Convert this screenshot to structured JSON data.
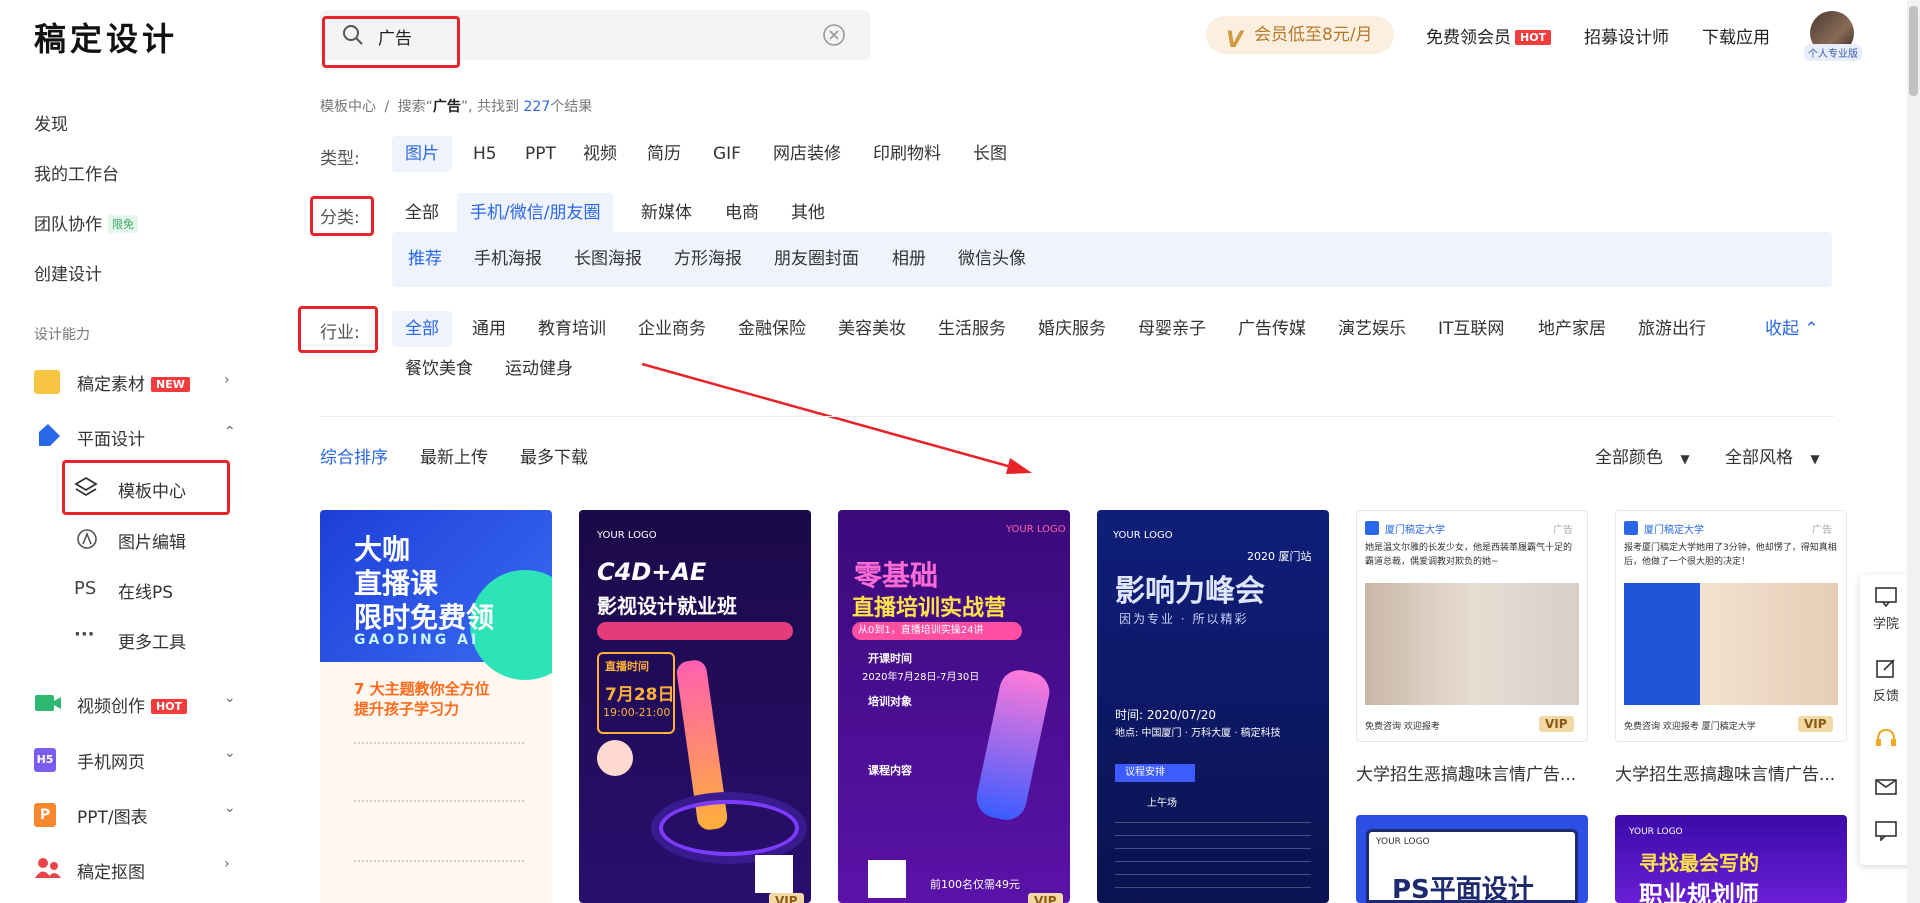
{
  "header": {
    "logo": "稿定设计",
    "search_value": "广告",
    "vip_label": "会员低至8元/月",
    "free_vip": "免费领会员",
    "hot": "HOT",
    "recruit": "招募设计师",
    "download": "下载应用",
    "avatar_badge": "个人专业版"
  },
  "sidebar": {
    "discover": "发现",
    "workbench": "我的工作台",
    "team": "团队协作",
    "team_tag": "限免",
    "create": "创建设计",
    "section": "设计能力",
    "materials": "稿定素材",
    "materials_tag": "NEW",
    "graphic": "平面设计",
    "template_center": "模板中心",
    "image_edit": "图片编辑",
    "online_ps": "在线PS",
    "ps_icon": "PS",
    "more_tools": "更多工具",
    "video": "视频创作",
    "video_tag": "HOT",
    "h5": "手机网页",
    "h5_icon": "H5",
    "ppt": "PPT/图表",
    "ppt_icon": "P",
    "cutout": "稿定抠图"
  },
  "breadcrumb": {
    "root": "模板中心",
    "sep": "/",
    "prefix": "搜索“",
    "query": "广告",
    "middle": "”, 共找到",
    "count": "227",
    "suffix": "个结果"
  },
  "filters": {
    "type_label": "类型:",
    "types": [
      "图片",
      "H5",
      "PPT",
      "视频",
      "简历",
      "GIF",
      "网店装修",
      "印刷物料",
      "长图"
    ],
    "category_label": "分类:",
    "categories": [
      "全部",
      "手机/微信/朋友圈",
      "新媒体",
      "电商",
      "其他"
    ],
    "subcategories": [
      "推荐",
      "手机海报",
      "长图海报",
      "方形海报",
      "朋友圈封面",
      "相册",
      "微信头像"
    ],
    "industry_label": "行业:",
    "industries": [
      "全部",
      "通用",
      "教育培训",
      "企业商务",
      "金融保险",
      "美容美妆",
      "生活服务",
      "婚庆服务",
      "母婴亲子",
      "广告传媒",
      "演艺娱乐",
      "IT互联网",
      "地产家居",
      "旅游出行"
    ],
    "industries_row2": [
      "餐饮美食",
      "运动健身"
    ],
    "collapse": "收起"
  },
  "sort": {
    "options": [
      "综合排序",
      "最新上传",
      "最多下载"
    ],
    "color": "全部颜色",
    "style": "全部风格"
  },
  "cards": [
    {
      "lines": [
        "大咖",
        "直播课",
        "限时免费领"
      ],
      "sub": "GAODING AI",
      "body": [
        "7 大主题教你全方位",
        "提升孩子学习力"
      ]
    },
    {
      "lines": [
        "C4D+AE",
        "影视设计就业班"
      ],
      "logo": "YOUR LOGO",
      "date_label": "直播时间",
      "date": "7月28日",
      "time": "19:00-21:00",
      "vip": "VIP"
    },
    {
      "lines": [
        "零基础",
        "直播培训实战营"
      ],
      "logo": "YOUR LOGO",
      "sub": "从0到1，直播培训实操24讲",
      "info": [
        "开课时间",
        "2020年7月28日-7月30日",
        "培训对象",
        "课程内容"
      ],
      "price": "前100名仅需49元",
      "vip": "VIP"
    },
    {
      "lines": [
        "影响力峰会"
      ],
      "logo": "YOUR LOGO",
      "sub": "因为专业 · 所以精彩",
      "city": "2020 厦门站",
      "time": "时间: 2020/07/20",
      "place": "地点: 中国厦门 · 万科大厦 · 稿定科技",
      "agenda": "议程安排",
      "am": "上午场"
    },
    {
      "account": "厦门稿定大学",
      "ad": "广告",
      "text": "她是温文尔雅的长发少女，他是西装革履霸气十足的霸道总裁，偶爱调教对欺负的她~",
      "foot": "免费咨询 欢迎报考",
      "vip": "VIP",
      "title": "大学招生恶搞趣味言情广告..."
    },
    {
      "account": "厦门稿定大学",
      "ad": "广告",
      "text": "报考厦门稿定大学她用了3分钟，他却愣了，得知真相后，他做了一个很大胆的决定！",
      "foot": "免费咨询 欢迎报考 厦门稿定大学",
      "vip": "VIP",
      "title": "大学招生恶搞趣味言情广告..."
    },
    {
      "lines": [
        "PS平面设计"
      ],
      "logo": "YOUR LOGO"
    },
    {
      "lines": [
        "寻找最会写的",
        "职业规划师"
      ],
      "logo": "YOUR LOGO"
    }
  ],
  "float": {
    "academy": "学院",
    "feedback": "反馈"
  },
  "colors": {
    "accent": "#2a67e6",
    "annotation": "#e8232a",
    "vip_bg": "#fbf0df"
  }
}
